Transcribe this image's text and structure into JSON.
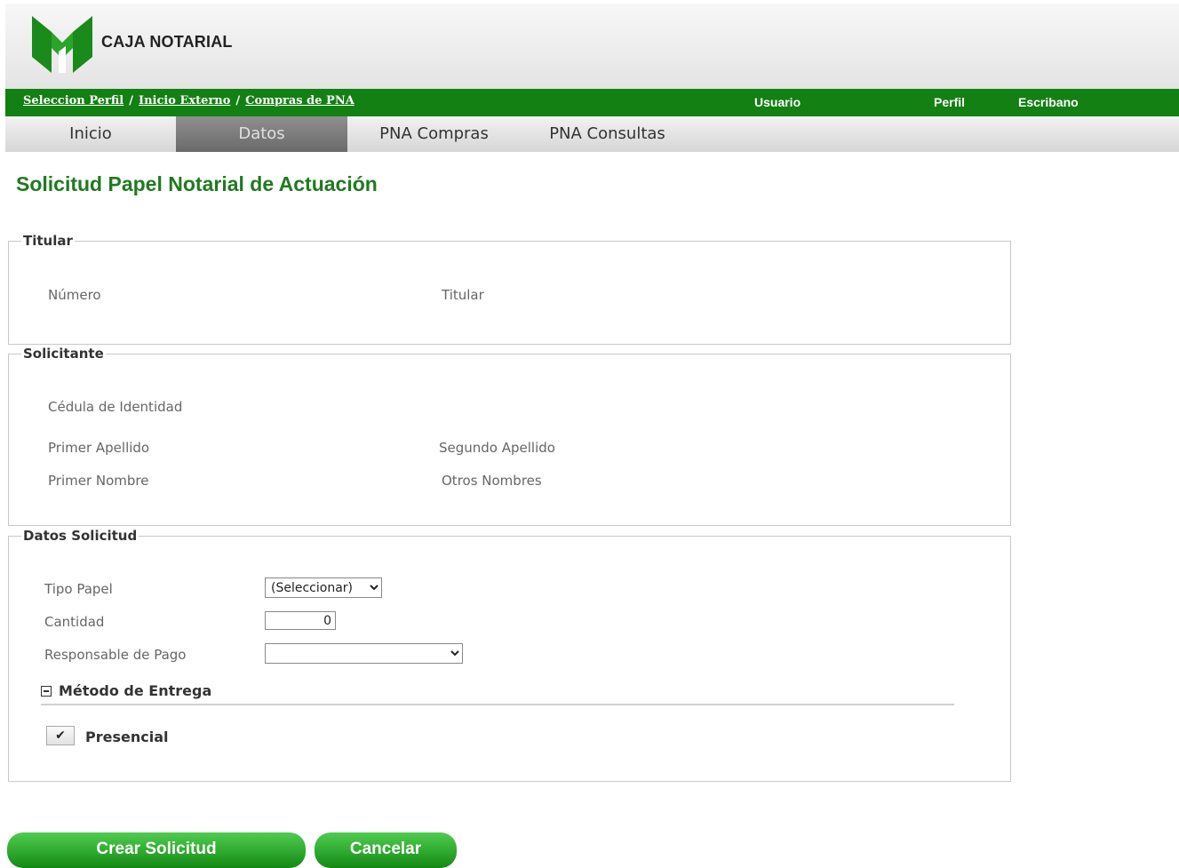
{
  "brand": {
    "name": "CAJA NOTARIAL"
  },
  "breadcrumb": [
    {
      "label": "Seleccion Perfil"
    },
    {
      "label": "Inicio Externo"
    },
    {
      "label": "Compras de PNA"
    }
  ],
  "breadcrumb_separator": "/",
  "user_info": {
    "usuario": "Usuario",
    "perfil": "Perfil",
    "rol": "Escribano"
  },
  "tabs": [
    {
      "label": "Inicio",
      "active": false
    },
    {
      "label": "Datos",
      "active": true
    },
    {
      "label": "PNA Compras",
      "active": false
    },
    {
      "label": "PNA Consultas",
      "active": false
    }
  ],
  "page_title": "Solicitud Papel Notarial de Actuación",
  "titular": {
    "legend": "Titular",
    "numero_label": "Número",
    "titular_label": "Titular"
  },
  "solicitante": {
    "legend": "Solicitante",
    "cedula_label": "Cédula de Identidad",
    "primer_apellido_label": "Primer Apellido",
    "segundo_apellido_label": "Segundo Apellido",
    "primer_nombre_label": "Primer Nombre",
    "otros_nombres_label": "Otros Nombres"
  },
  "datos_solicitud": {
    "legend": "Datos Solicitud",
    "tipo_papel_label": "Tipo Papel",
    "tipo_papel_value": "(Seleccionar)",
    "cantidad_label": "Cantidad",
    "cantidad_value": "0",
    "responsable_label": "Responsable de Pago",
    "responsable_value": "",
    "metodo_entrega_title": "Método de Entrega",
    "presencial_label": "Presencial",
    "presencial_checked": true
  },
  "buttons": {
    "crear": "Crear Solicitud",
    "cancelar": "Cancelar"
  },
  "colors": {
    "brand_green": "#128012",
    "title_green": "#1f7a1f",
    "button_green": "#2fae2f"
  }
}
